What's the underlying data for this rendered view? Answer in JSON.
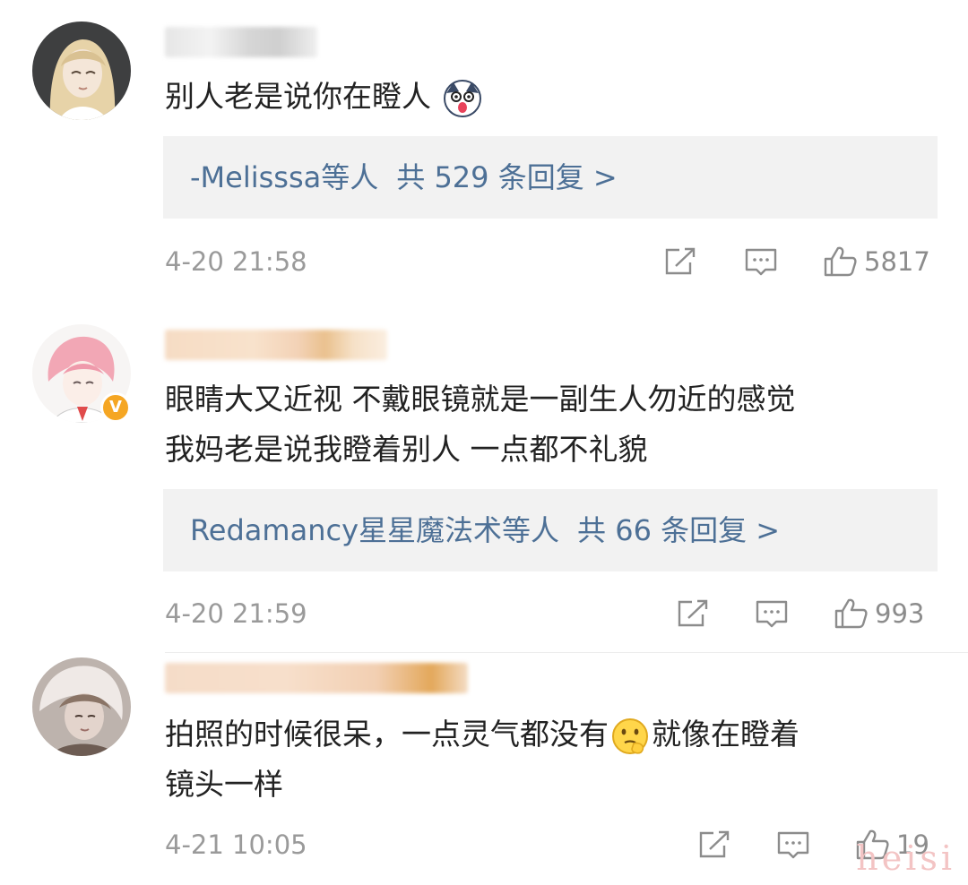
{
  "comments": [
    {
      "text_lines": [
        "别人老是说你在瞪人"
      ],
      "emoji": "shocked-dog-emoji",
      "reply": {
        "names": "-Melisssa",
        "suffix": "等人",
        "count": "共 529 条回复 >"
      },
      "time": "4-20 21:58",
      "likes": "5817",
      "verified": false
    },
    {
      "text_lines": [
        "眼睛大又近视 不戴眼镜就是一副生人勿近的感觉",
        "我妈老是说我瞪着别人 一点都不礼貌"
      ],
      "reply": {
        "names": "Redamancy星星魔法术",
        "suffix": "等人",
        "count": "共 66 条回复 >"
      },
      "time": "4-20 21:59",
      "likes": "993",
      "verified": true,
      "verified_badge": "V"
    },
    {
      "text_part1": "拍照的时候很呆，一点灵气都没有",
      "emoji": "thinking-face-emoji",
      "text_part2": "就像在瞪着",
      "text_line2": "镜头一样",
      "time": "4-21 10:05",
      "likes": "19",
      "verified": false
    }
  ],
  "watermark": "heisi",
  "colors": {
    "link": "#4d7096",
    "meta": "#9a9a9a",
    "reply_bg": "#f2f2f2",
    "badge": "#f5a623"
  },
  "icons": [
    "share-icon",
    "comment-icon",
    "like-icon"
  ]
}
